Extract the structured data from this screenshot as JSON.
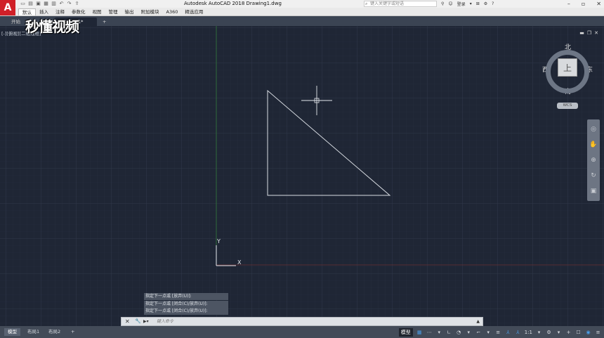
{
  "app": {
    "logo": "A",
    "window_title": "Autodesk AutoCAD 2018    Drawing1.dwg",
    "search_placeholder": "键入关键字或短语",
    "user_label": "登录",
    "help_label": "?"
  },
  "ribbon": {
    "tabs": [
      {
        "label": "默认",
        "active": true
      },
      {
        "label": "插入",
        "active": false
      },
      {
        "label": "注释",
        "active": false
      },
      {
        "label": "参数化",
        "active": false
      },
      {
        "label": "视图",
        "active": false
      },
      {
        "label": "管理",
        "active": false
      },
      {
        "label": "输出",
        "active": false
      },
      {
        "label": "附加模块",
        "active": false
      },
      {
        "label": "A360",
        "active": false
      },
      {
        "label": "精选应用",
        "active": false
      }
    ]
  },
  "doc_tabs": {
    "start": "开始",
    "drawing": "Drawing1*",
    "add": "+"
  },
  "viewport": {
    "label": "[-][俯视][二维线框]",
    "ucs_x": "X",
    "ucs_y": "Y"
  },
  "viewcube": {
    "north": "北",
    "south": "南",
    "east": "东",
    "west": "西",
    "face": "上",
    "wcs": "WCS"
  },
  "command_history": [
    "指定下一点或 [放弃(U)]:",
    "指定下一点或 [闭合(C)/放弃(U)]:",
    "指定下一点或 [闭合(C)/放弃(U)]:"
  ],
  "command_input_placeholder": "键入命令",
  "status": {
    "tabs": {
      "model": "模型",
      "layout1": "布局1",
      "layout2": "布局2",
      "add": "+"
    },
    "model_button": "模型",
    "scale": "1:1"
  },
  "watermark": "秒懂视频",
  "colors": {
    "background": "#1f2635",
    "line": "#d9dde3",
    "accent": "#4a9de8"
  }
}
